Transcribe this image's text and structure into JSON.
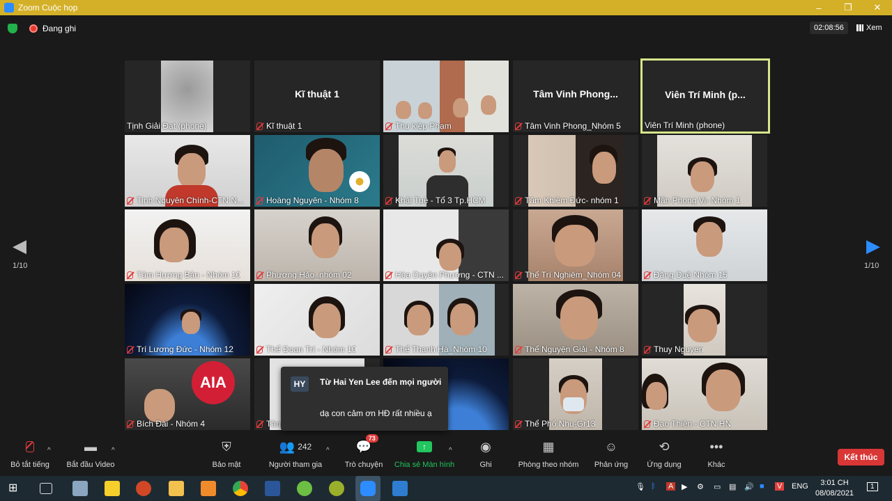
{
  "window": {
    "title": "Zoom Cuộc họp",
    "controls": [
      "–",
      "❐",
      "✕"
    ]
  },
  "topbar": {
    "recording": "Đang ghi",
    "timer": "02:08:56",
    "view": "Xem"
  },
  "pagination": {
    "left": "1/10",
    "right": "1/10"
  },
  "tiles": [
    {
      "label": "Tịnh Giải Đạt (phone)",
      "big": ""
    },
    {
      "label": "Kĩ thuật 1",
      "big": "Kĩ thuật 1"
    },
    {
      "label": "Thu kiệp Phạm",
      "big": ""
    },
    {
      "label": "Tâm Vinh Phong_Nhóm 5",
      "big": "Tâm Vinh Phong..."
    },
    {
      "label": "Viên Trí Minh (phone)",
      "big": "Viên Trí Minh (p..."
    },
    {
      "label": "Tịnh Nguyên Chính-CTN N...",
      "big": ""
    },
    {
      "label": "Hoàng Nguyên - Nhóm 8",
      "big": ""
    },
    {
      "label": "Khải Tuệ - Tổ 3 Tp.HCM",
      "big": ""
    },
    {
      "label": "Tâm Khiêm Đức- nhóm 1",
      "big": ""
    },
    {
      "label": "Mẫn Phong Vi- Nhóm 1",
      "big": ""
    },
    {
      "label": "Tâm Hương Bản - Nhóm 10",
      "big": ""
    },
    {
      "label": "Phương Hảo_nhóm 02",
      "big": ""
    },
    {
      "label": "Hòa Duyên Phương - CTN ...",
      "big": ""
    },
    {
      "label": "Thể Trí Nghiêm_Nhóm 04",
      "big": ""
    },
    {
      "label": "Đăng Duệ Nhóm 15",
      "big": ""
    },
    {
      "label": "Trí Lương Đức - Nhóm 12",
      "big": ""
    },
    {
      "label": "Thể Đoan Trí - Nhóm 10",
      "big": ""
    },
    {
      "label": "Thể Thanh Hà_Nhóm 10",
      "big": ""
    },
    {
      "label": "Thể Nguyện Giải - Nhóm 8",
      "big": ""
    },
    {
      "label": "Thuy Nguyen",
      "big": ""
    },
    {
      "label": "Bích Đài - Nhóm 4",
      "big": ""
    },
    {
      "label": "Tân",
      "big": ""
    },
    {
      "label": "",
      "big": ""
    },
    {
      "label": "Thể Phổ Nhu-Gr13",
      "big": ""
    },
    {
      "label": "Đạo Thiện - CTN HN",
      "big": ""
    }
  ],
  "aia_logo": "AIA",
  "chat_popup": {
    "initials": "HY",
    "from": "Từ Hai Yen Lee đến mọi người",
    "message": "dạ con cảm ơn HĐ rất nhiều ạ"
  },
  "toolbar": {
    "mute": "Bỏ tắt tiếng",
    "video": "Bắt đầu Video",
    "security": "Bảo mật",
    "participants": "Người tham gia",
    "participants_count": "242",
    "chat": "Trò chuyện",
    "chat_badge": "73",
    "share": "Chia sẻ Màn hình",
    "record": "Ghi",
    "breakout": "Phòng theo nhóm",
    "reactions": "Phản ứng",
    "apps": "Ứng dụng",
    "more": "Khác",
    "end": "Kết thúc"
  },
  "taskbar": {
    "lang": "ENG",
    "time": "3:01 CH",
    "date": "08/08/2021",
    "notif": "1"
  },
  "colors": {
    "titlebar": "#d4b028",
    "active_speaker": "#d6e68a",
    "end": "#d93636",
    "share": "#22c55e"
  }
}
